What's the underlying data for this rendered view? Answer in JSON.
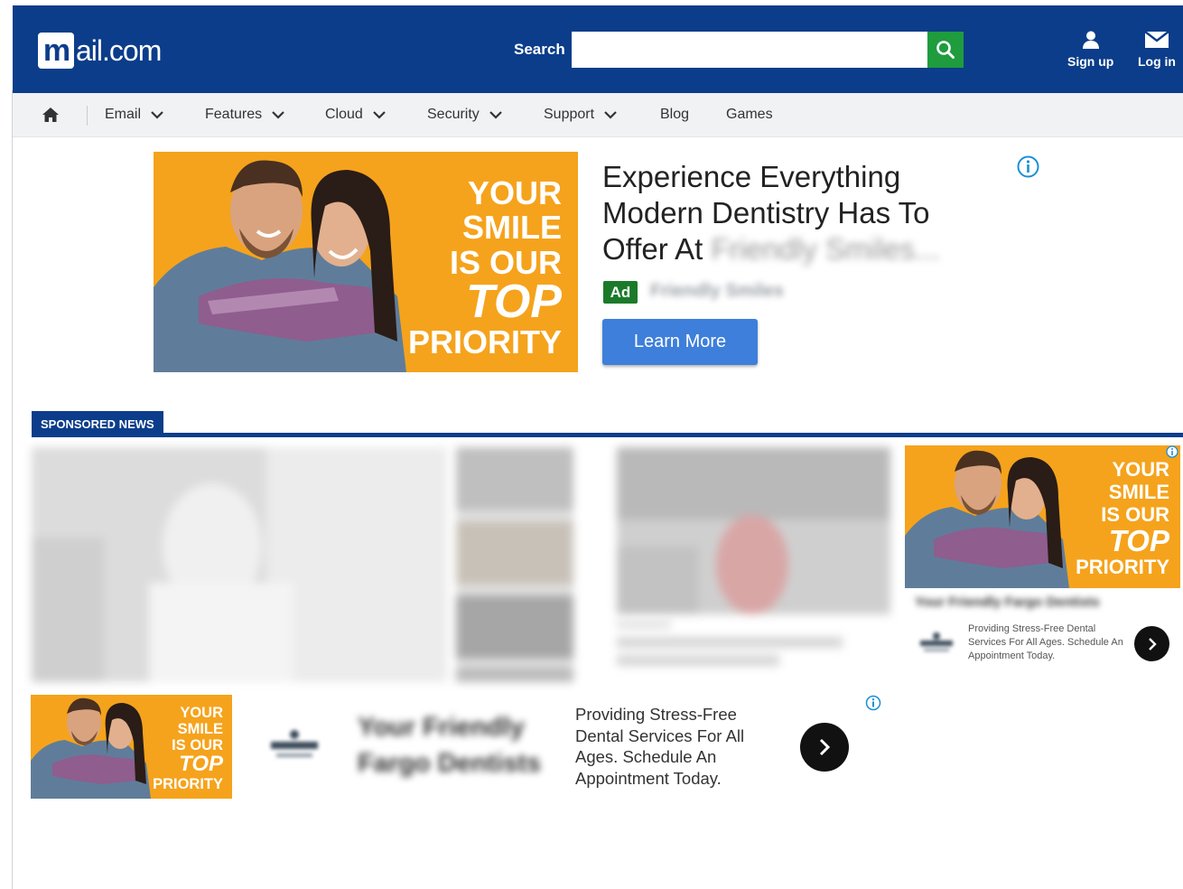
{
  "header": {
    "logo_m": "m",
    "logo_rest": "ail.com",
    "search_label": "Search",
    "search_placeholder": "",
    "signup_label": "Sign up",
    "login_label": "Log in"
  },
  "nav": {
    "items": [
      {
        "label": "Email",
        "dropdown": true
      },
      {
        "label": "Features",
        "dropdown": true
      },
      {
        "label": "Cloud",
        "dropdown": true
      },
      {
        "label": "Security",
        "dropdown": true
      },
      {
        "label": "Support",
        "dropdown": true
      },
      {
        "label": "Blog",
        "dropdown": false
      },
      {
        "label": "Games",
        "dropdown": false
      }
    ]
  },
  "top_ad": {
    "image_text": [
      "YOUR",
      "SMILE",
      "IS OUR",
      "TOP",
      "PRIORITY"
    ],
    "headline": "Experience Everything Modern Dentistry Has To Offer At",
    "headline_blurred": "Friendly Smiles...",
    "badge": "Ad",
    "source_blurred": "Friendly Smiles",
    "cta": "Learn More"
  },
  "sponsored": {
    "tab_label": "SPONSORED NEWS"
  },
  "side_ad": {
    "image_text": [
      "YOUR",
      "SMILE",
      "IS OUR",
      "TOP",
      "PRIORITY"
    ],
    "title_blurred": "Your Friendly Fargo Dentists",
    "description": "Providing Stress-Free Dental Services For All Ages. Schedule An Appointment Today."
  },
  "bottom_ad": {
    "image_text": [
      "YOUR",
      "SMILE",
      "IS OUR",
      "TOP",
      "PRIORITY"
    ],
    "title_blurred": "Your Friendly Fargo Dentists",
    "description": "Providing Stress-Free Dental Services For All Ages. Schedule An Appointment Today."
  },
  "colors": {
    "brand_blue": "#0b3d8a",
    "search_green": "#1e9c3e",
    "ad_orange": "#f5a31c",
    "ad_badge_green": "#1b7a2a",
    "cta_blue": "#3d7fdb"
  }
}
